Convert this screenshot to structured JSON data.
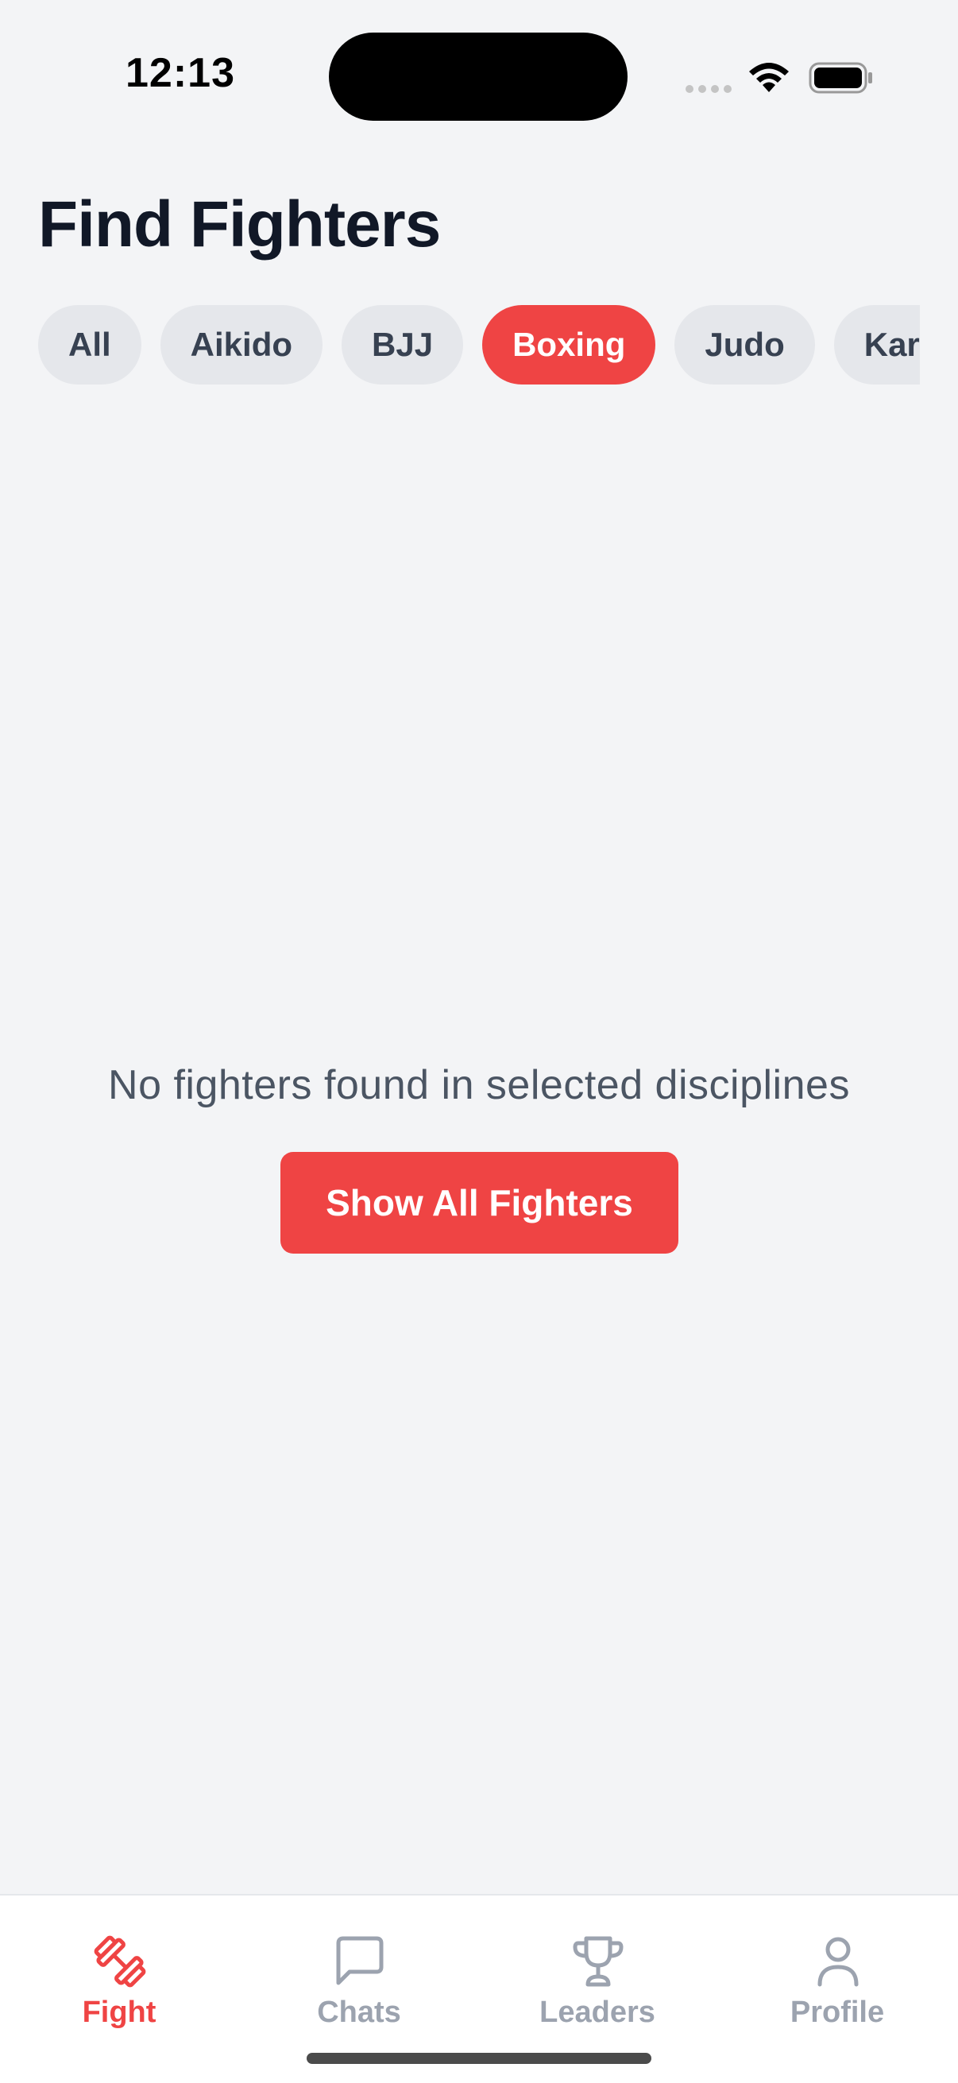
{
  "status_bar": {
    "time": "12:13"
  },
  "header": {
    "title": "Find Fighters"
  },
  "filters": {
    "chips": [
      {
        "label": "All",
        "active": false
      },
      {
        "label": "Aikido",
        "active": false
      },
      {
        "label": "BJJ",
        "active": false
      },
      {
        "label": "Boxing",
        "active": true
      },
      {
        "label": "Judo",
        "active": false
      },
      {
        "label": "Karate",
        "active": false
      }
    ]
  },
  "empty_state": {
    "message": "No fighters found in selected disciplines",
    "button_label": "Show All Fighters"
  },
  "tab_bar": {
    "tabs": [
      {
        "label": "Fight",
        "icon": "dumbbell-icon",
        "active": true
      },
      {
        "label": "Chats",
        "icon": "chat-bubble-icon",
        "active": false
      },
      {
        "label": "Leaders",
        "icon": "trophy-icon",
        "active": false
      },
      {
        "label": "Profile",
        "icon": "user-icon",
        "active": false
      }
    ]
  },
  "colors": {
    "accent": "#ef4444",
    "background": "#f3f4f6",
    "chip_inactive": "#e5e7eb",
    "tab_inactive": "#9ca3af"
  }
}
